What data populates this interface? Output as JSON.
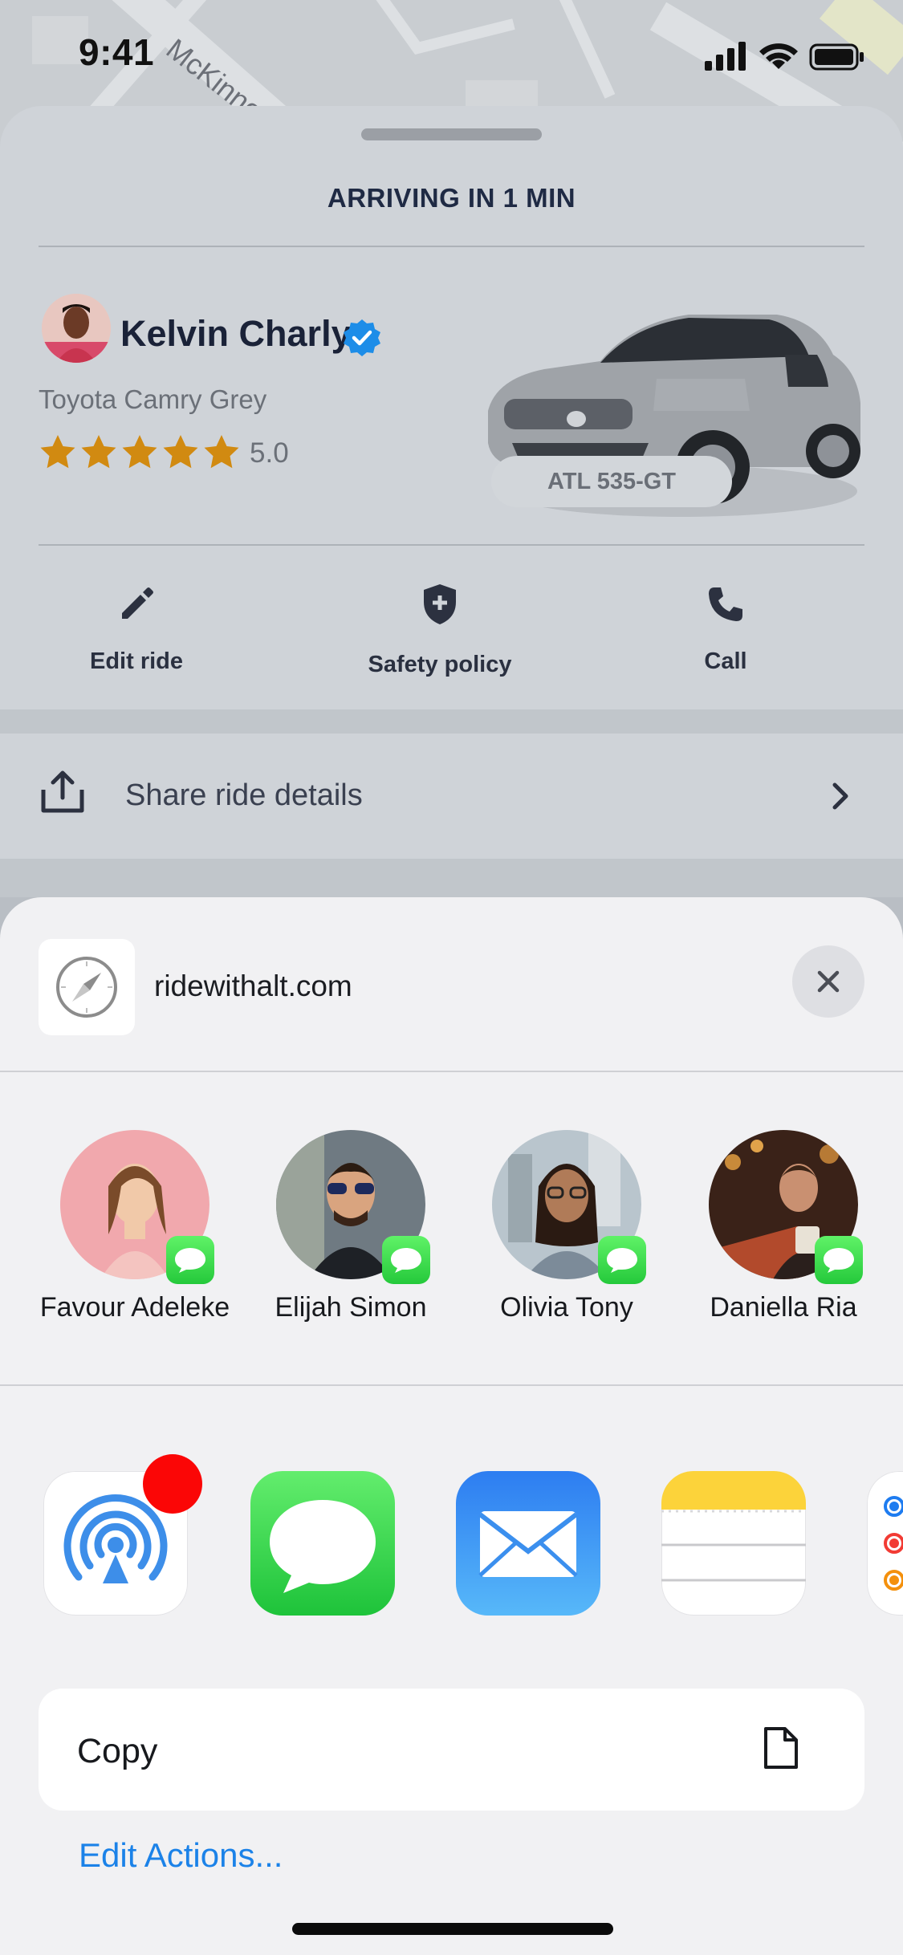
{
  "status_bar": {
    "time": "9:41"
  },
  "map": {
    "street_label": "McKinnon"
  },
  "ride": {
    "status": "ARRIVING IN 1 MIN",
    "driver": {
      "name": "Kelvin Charly",
      "car_model": "Toyota Camry Grey",
      "rating": "5.0",
      "stars": 5,
      "plate": "ATL 535-GT"
    },
    "actions": [
      {
        "label": "Edit ride",
        "icon": "pencil-icon"
      },
      {
        "label": "Safety policy",
        "icon": "shield-icon"
      },
      {
        "label": "Call",
        "icon": "phone-icon"
      }
    ],
    "share": {
      "label": "Share ride details"
    }
  },
  "share_sheet": {
    "url": "ridewithalt.com",
    "contacts": [
      {
        "name": "Favour Adeleke"
      },
      {
        "name": "Elijah Simon"
      },
      {
        "name": "Olivia Tony"
      },
      {
        "name": "Daniella Ria"
      }
    ],
    "apps": [
      {
        "name": "airdrop-icon"
      },
      {
        "name": "messages-icon"
      },
      {
        "name": "mail-icon"
      },
      {
        "name": "notes-icon"
      },
      {
        "name": "reminders-icon"
      }
    ],
    "copy": {
      "label": "Copy"
    },
    "edit_actions": "Edit Actions..."
  },
  "colors": {
    "star": "#d18a11",
    "verified": "#1d8de8",
    "link": "#1b82e8",
    "airdrop_badge": "#fb0606"
  }
}
